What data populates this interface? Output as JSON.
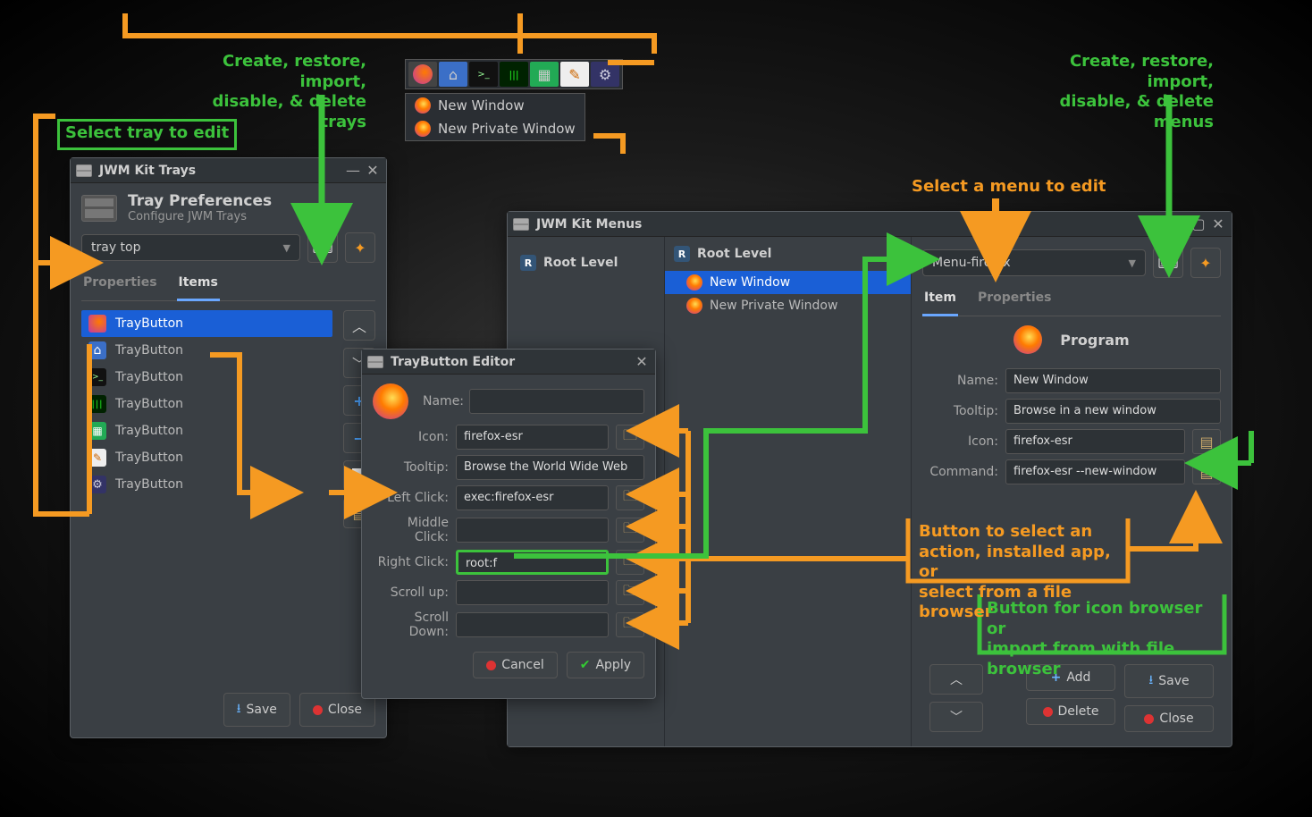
{
  "annotations": {
    "create_trays": "Create, restore, import,\ndisable, & delete trays",
    "select_tray": "Select tray to edit",
    "create_menus": "Create, restore, import,\ndisable, & delete menus",
    "select_menu": "Select a menu to edit",
    "button_action": "Button to select an\naction, installed app, or\nselect from a file browser",
    "button_icon": "Button for icon browser or\nimport from with file browser"
  },
  "traybar": {
    "menu": [
      "New Window",
      "New Private Window"
    ]
  },
  "trays_window": {
    "title": "JWM Kit Trays",
    "header": "Tray Preferences",
    "subheader": "Configure JWM Trays",
    "selected_tray": "tray top",
    "tabs": {
      "properties": "Properties",
      "items": "Items"
    },
    "items": [
      "TrayButton",
      "TrayButton",
      "TrayButton",
      "TrayButton",
      "TrayButton",
      "TrayButton",
      "TrayButton"
    ],
    "save": "Save",
    "close": "Close"
  },
  "editor_window": {
    "title": "TrayButton Editor",
    "name_label": "Name:",
    "icon_label": "Icon:",
    "icon_value": "firefox-esr",
    "tooltip_label": "Tooltip:",
    "tooltip_value": "Browse the World Wide Web",
    "left_label": "Left Click:",
    "left_value": "exec:firefox-esr",
    "middle_label": "Middle Click:",
    "right_label": "Right Click:",
    "right_value": "root:f",
    "scrollup_label": "Scroll up:",
    "scrolldown_label": "Scroll Down:",
    "cancel": "Cancel",
    "apply": "Apply"
  },
  "menus_window": {
    "title": "JWM Kit Menus",
    "root_left": "Root Level",
    "tree": {
      "root": "Root Level",
      "items": [
        "New Window",
        "New Private Window"
      ]
    },
    "selected_menu": "Menu-firefox",
    "tabs": {
      "item": "Item",
      "properties": "Properties"
    },
    "program_header": "Program",
    "name_label": "Name:",
    "name_value": "New Window",
    "tooltip_label": "Tooltip:",
    "tooltip_value": "Browse in a new window",
    "icon_label": "Icon:",
    "icon_value": "firefox-esr",
    "command_label": "Command:",
    "command_value": "firefox-esr --new-window",
    "add": "Add",
    "save": "Save",
    "delete": "Delete",
    "close": "Close"
  }
}
